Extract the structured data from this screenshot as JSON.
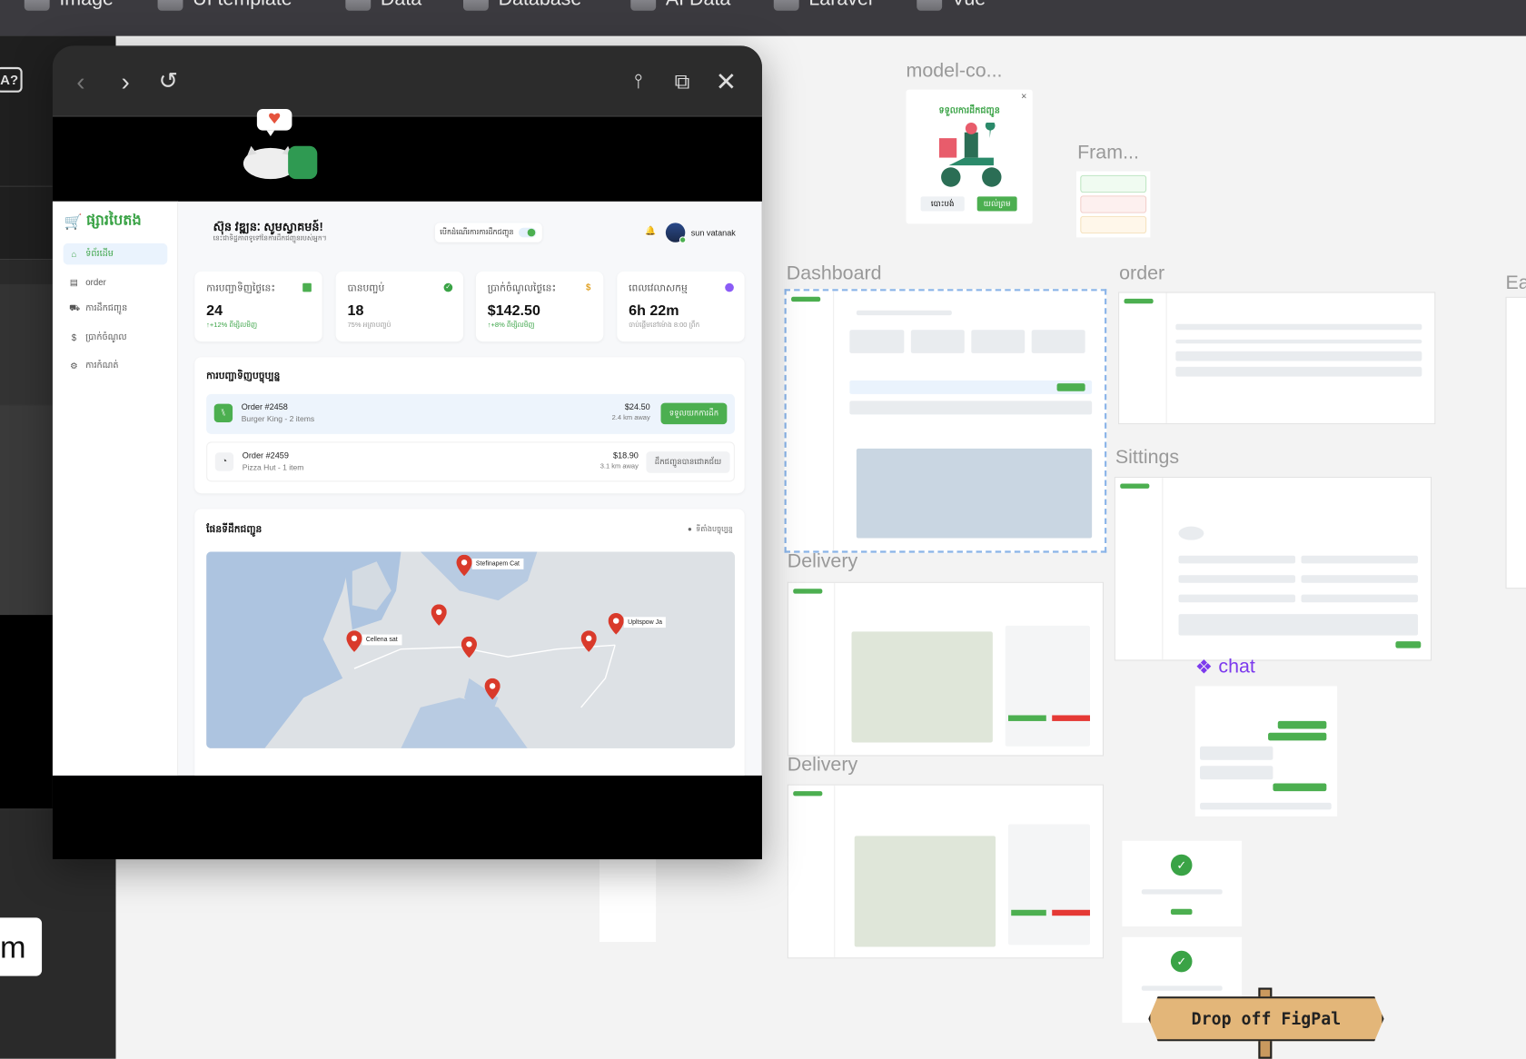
{
  "bookmarks": [
    "Image",
    "UI template",
    "Data",
    "Database",
    "AI Data",
    "Laravel",
    "Vue"
  ],
  "left_panel": {
    "badge": "A?",
    "bottom_label": "m"
  },
  "window": {
    "toolbar": {
      "back": "back",
      "forward": "forward",
      "refresh": "refresh",
      "settings": "settings",
      "open_external": "open-external",
      "close": "close"
    }
  },
  "app": {
    "logo": "ផ្សារបៃតង",
    "nav": [
      {
        "label": "ទំព័រដើម",
        "icon": "home",
        "active": true
      },
      {
        "label": "order",
        "icon": "clipboard"
      },
      {
        "label": "ការដឹកជញ្ជូន",
        "icon": "delivery"
      },
      {
        "label": "ប្រាក់ចំណូល",
        "icon": "dollar"
      },
      {
        "label": "ការកំណត់",
        "icon": "gear"
      }
    ],
    "header": {
      "title": "ស៊ុន វឌ្ឍនៈ សូមស្វាគមន៍!",
      "subtitle": "នេះជាទិដ្ឋភាពទូទៅនៃការដឹកជញ្ជូនរបស់អ្នក។",
      "toggle_label": "បើកដំណើរការការដឹកជញ្ជូន",
      "toggle_on": true,
      "user": "sun vatanak"
    },
    "stats": [
      {
        "label": "ការបញ្ជាទិញថ្ងៃនេះ",
        "value": "24",
        "sub": "↑+12% ពីម្សិលមិញ",
        "up": true,
        "color": "#4caf50"
      },
      {
        "label": "បានបញ្ចប់",
        "value": "18",
        "sub": "75% អត្រាបញ្ចប់",
        "up": false,
        "color": "#3aa346"
      },
      {
        "label": "ប្រាក់ចំណូលថ្ងៃនេះ",
        "value": "$142.50",
        "sub": "↑+8% ពីម្សិលមិញ",
        "up": true,
        "color": "#e0a020"
      },
      {
        "label": "ពេលវេលាសកម្ម",
        "value": "6h 22m",
        "sub": "ចាប់ផ្តើមនៅម៉ោង 8:00 ព្រឹក",
        "up": false,
        "color": "#8b5cf6"
      }
    ],
    "orders_title": "ការបញ្ជាទិញបច្ចុប្បន្ន",
    "orders": [
      {
        "id": "Order #2458",
        "desc": "Burger King - 2 items",
        "price": "$24.50",
        "distance": "2.4 km away",
        "action": "ទទួលយកការដឹក"
      },
      {
        "id": "Order #2459",
        "desc": "Pizza Hut - 1 item",
        "price": "$18.90",
        "distance": "3.1 km away",
        "action": "ដឹកជញ្ជូនបានជោគជ័យ"
      }
    ],
    "map": {
      "title": "ផែនទីដឹកជញ្ជូន",
      "location_label": "ទីតាំងបច្ចុប្បន្ន",
      "pins": [
        "Stefinapem Cat",
        "Cellena sat",
        "Upltspow Ja"
      ]
    }
  },
  "canvas": {
    "frames": [
      "model-co...",
      "Fram...",
      "Dashboard",
      "order",
      "Ea",
      "Sittings",
      "Delivery",
      "Delivery",
      "chat"
    ],
    "modal": {
      "title": "ទទួលការដឹកជញ្ជូន",
      "cancel": "បោះបង់",
      "ok": "យល់ព្រម"
    },
    "sign": "Drop off FigPal"
  },
  "colors": {
    "accent": "#4caf50",
    "pin": "#d93a2b",
    "dark": "#2c2c2c"
  }
}
